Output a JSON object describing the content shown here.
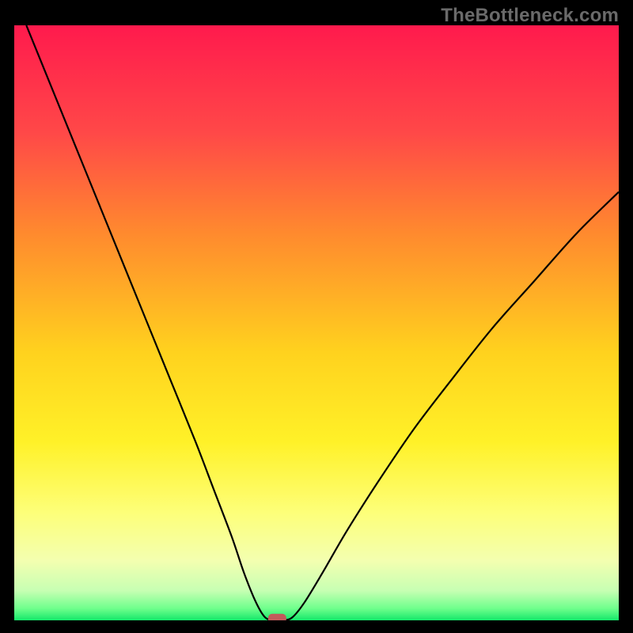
{
  "watermark": "TheBottleneck.com",
  "chart_data": {
    "type": "line",
    "title": "",
    "xlabel": "",
    "ylabel": "",
    "xlim": [
      0,
      100
    ],
    "ylim": [
      0,
      100
    ],
    "grid": false,
    "legend": false,
    "background_gradient": {
      "stops": [
        {
          "offset": 0.0,
          "color": "#ff1a4d"
        },
        {
          "offset": 0.18,
          "color": "#ff4848"
        },
        {
          "offset": 0.35,
          "color": "#ff8a2e"
        },
        {
          "offset": 0.55,
          "color": "#ffd21e"
        },
        {
          "offset": 0.7,
          "color": "#fff128"
        },
        {
          "offset": 0.82,
          "color": "#fdff7a"
        },
        {
          "offset": 0.9,
          "color": "#f3ffb0"
        },
        {
          "offset": 0.95,
          "color": "#c7ffb3"
        },
        {
          "offset": 0.98,
          "color": "#6fff8c"
        },
        {
          "offset": 1.0,
          "color": "#14e86a"
        }
      ]
    },
    "series": [
      {
        "name": "bottleneck-curve",
        "stroke": "#000000",
        "points": [
          {
            "x": 2.0,
            "y": 100.0
          },
          {
            "x": 6.0,
            "y": 90.0
          },
          {
            "x": 10.0,
            "y": 80.0
          },
          {
            "x": 14.0,
            "y": 70.0
          },
          {
            "x": 18.0,
            "y": 60.0
          },
          {
            "x": 22.0,
            "y": 50.0
          },
          {
            "x": 26.0,
            "y": 40.0
          },
          {
            "x": 30.0,
            "y": 30.0
          },
          {
            "x": 33.0,
            "y": 22.0
          },
          {
            "x": 36.0,
            "y": 14.0
          },
          {
            "x": 38.0,
            "y": 8.0
          },
          {
            "x": 40.0,
            "y": 3.0
          },
          {
            "x": 41.5,
            "y": 0.5
          },
          {
            "x": 43.0,
            "y": 0.0
          },
          {
            "x": 44.5,
            "y": 0.0
          },
          {
            "x": 46.0,
            "y": 0.5
          },
          {
            "x": 48.0,
            "y": 3.0
          },
          {
            "x": 51.0,
            "y": 8.0
          },
          {
            "x": 55.0,
            "y": 15.0
          },
          {
            "x": 60.0,
            "y": 23.0
          },
          {
            "x": 66.0,
            "y": 32.0
          },
          {
            "x": 72.0,
            "y": 40.0
          },
          {
            "x": 79.0,
            "y": 49.0
          },
          {
            "x": 86.0,
            "y": 57.0
          },
          {
            "x": 93.0,
            "y": 65.0
          },
          {
            "x": 100.0,
            "y": 72.0
          }
        ]
      }
    ],
    "marker": {
      "name": "optimum-marker",
      "x": 43.5,
      "y": 0.3,
      "width": 3.0,
      "height": 1.6,
      "fill": "#c25b5b"
    }
  }
}
